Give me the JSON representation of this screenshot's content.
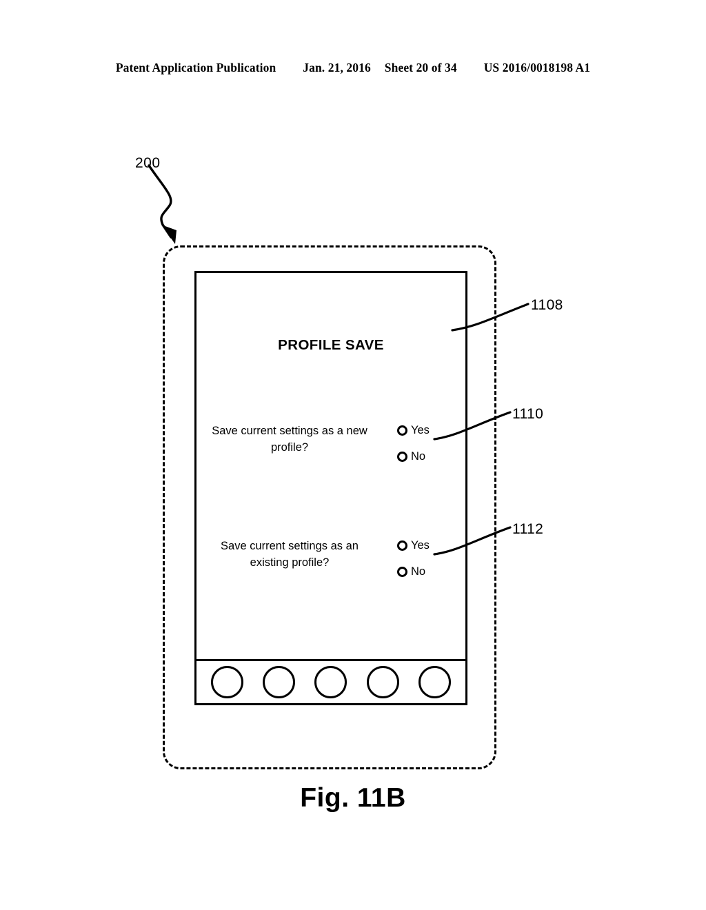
{
  "page_header": {
    "publication_label": "Patent Application Publication",
    "date": "Jan. 21, 2016",
    "sheet": "Sheet 20 of 34",
    "publication_number": "US 2016/0018198 A1"
  },
  "figure": {
    "caption": "Fig. 11B",
    "device_reference": "200",
    "reference_numerals": {
      "screen": "1108",
      "new_profile_options": "1110",
      "existing_profile_options": "1112"
    }
  },
  "screen": {
    "title": "PROFILE SAVE",
    "questions": [
      {
        "prompt": "Save current settings as a new profile?",
        "options": [
          {
            "label": "Yes",
            "selected": false
          },
          {
            "label": "No",
            "selected": false
          }
        ]
      },
      {
        "prompt": "Save current settings as an existing profile?",
        "options": [
          {
            "label": "Yes",
            "selected": false
          },
          {
            "label": "No",
            "selected": false
          }
        ]
      }
    ],
    "button_bar": {
      "button_count": 5
    }
  },
  "colors": {
    "ink": "#000000",
    "background": "#ffffff"
  }
}
